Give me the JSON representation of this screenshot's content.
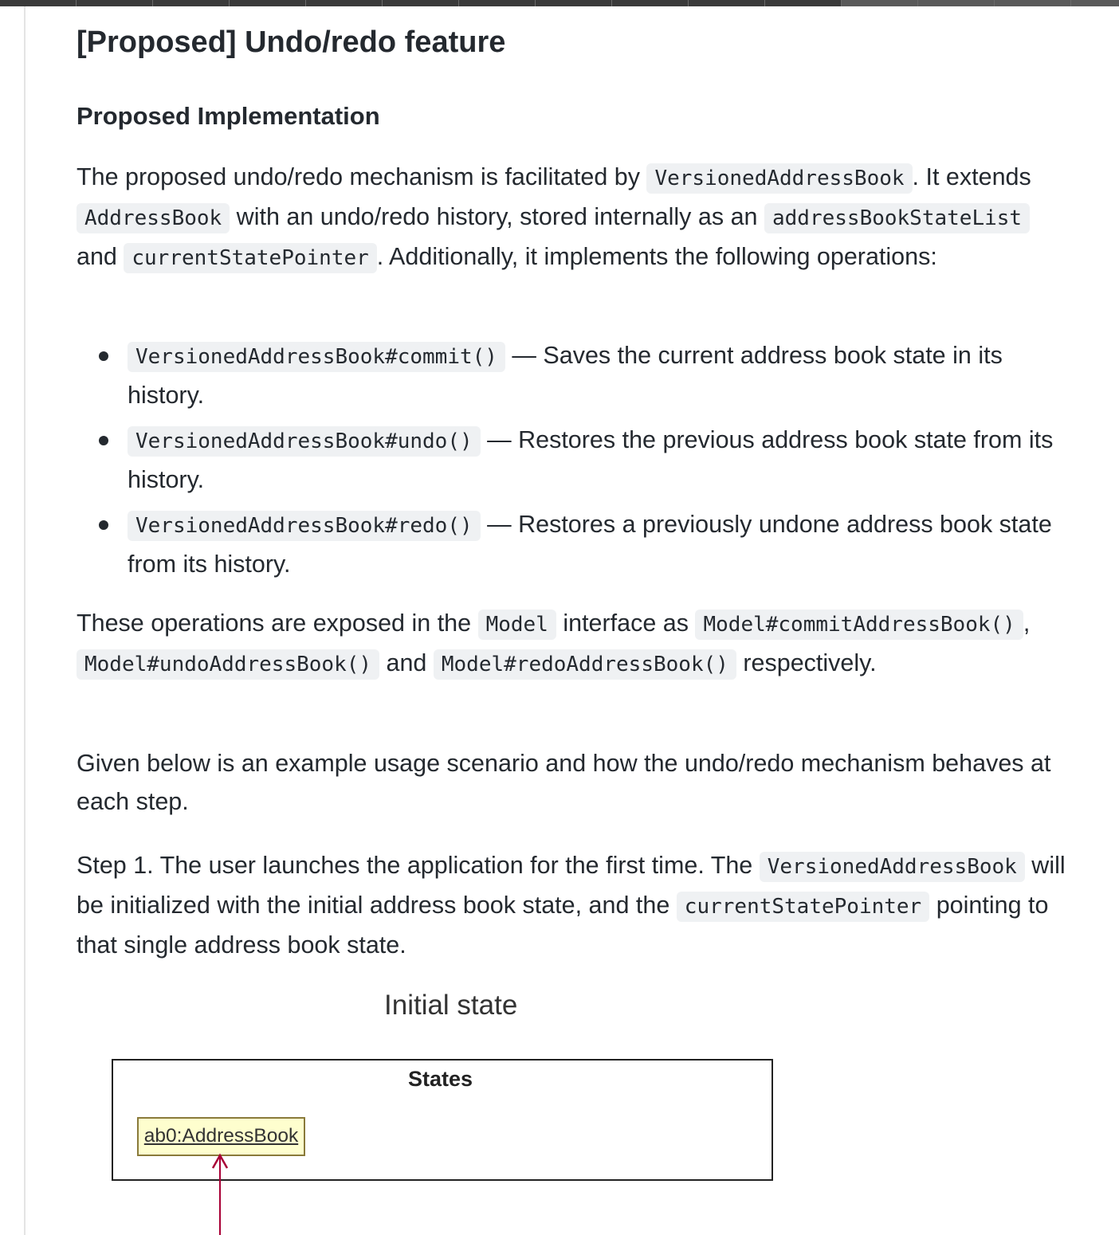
{
  "heading": "[Proposed] Undo/redo feature",
  "subheading": "Proposed Implementation",
  "intro": {
    "t1": "The proposed undo/redo mechanism is facilitated by ",
    "c1": "VersionedAddressBook",
    "t2": ". It extends ",
    "c2": "AddressBook",
    "t3": " with an undo/redo history, stored internally as an ",
    "c3": "addressBookStateList",
    "t4": " and ",
    "c4": "currentStatePointer",
    "t5": ". Additionally, it implements the following operations:"
  },
  "operations": [
    {
      "code": "VersionedAddressBook#commit()",
      "desc": " — Saves the current address book state in its history."
    },
    {
      "code": "VersionedAddressBook#undo()",
      "desc": " — Restores the previous address book state from its history."
    },
    {
      "code": "VersionedAddressBook#redo()",
      "desc": " — Restores a previously undone address book state from its history."
    }
  ],
  "exposed": {
    "t1": "These operations are exposed in the ",
    "c1": "Model",
    "t2": " interface as ",
    "c2": "Model#commitAddressBook()",
    "t3": ", ",
    "c3": "Model#undoAddressBook()",
    "t4": " and ",
    "c4": "Model#redoAddressBook()",
    "t5": " respectively."
  },
  "scenario": "Given below is an example usage scenario and how the undo/redo mechanism behaves at each step.",
  "step1": {
    "t1": "Step 1. The user launches the application for the first time. The ",
    "c1": "VersionedAddressBook",
    "t2": " will be initialized with the initial address book state, and the ",
    "c2": "currentStatePointer",
    "t3": " pointing to that single address book state."
  },
  "diagram": {
    "title": "Initial state",
    "container_label": "States",
    "object_label": "ab0:AddressBook",
    "arrow_color": "#a80036",
    "object_fill": "#fefece"
  }
}
